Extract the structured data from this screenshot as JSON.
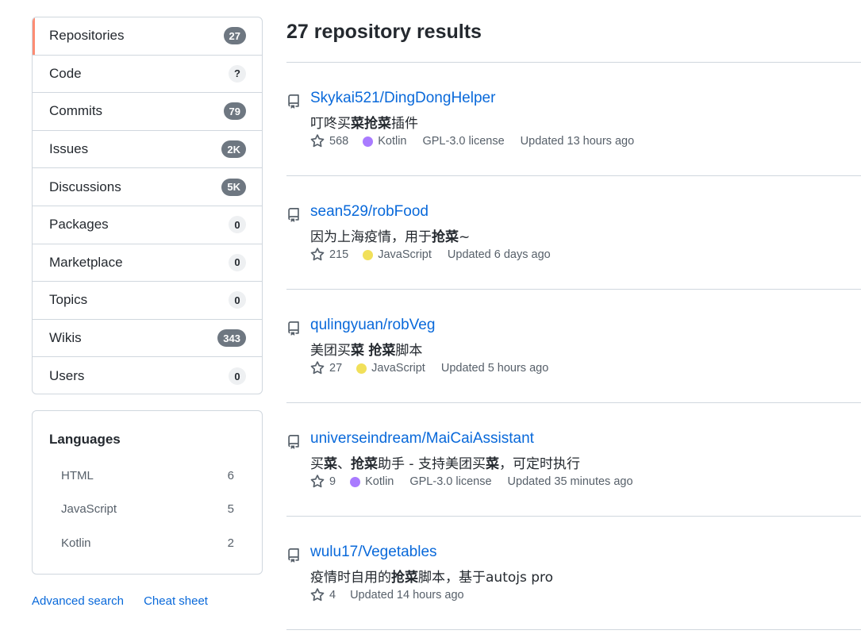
{
  "nav": [
    {
      "label": "Repositories",
      "count": "27",
      "dark": true,
      "selected": true
    },
    {
      "label": "Code",
      "count": "?",
      "dark": false
    },
    {
      "label": "Commits",
      "count": "79",
      "dark": true
    },
    {
      "label": "Issues",
      "count": "2K",
      "dark": true
    },
    {
      "label": "Discussions",
      "count": "5K",
      "dark": true
    },
    {
      "label": "Packages",
      "count": "0",
      "dark": false
    },
    {
      "label": "Marketplace",
      "count": "0",
      "dark": false
    },
    {
      "label": "Topics",
      "count": "0",
      "dark": false
    },
    {
      "label": "Wikis",
      "count": "343",
      "dark": true
    },
    {
      "label": "Users",
      "count": "0",
      "dark": false
    }
  ],
  "languages": {
    "title": "Languages",
    "items": [
      {
        "name": "HTML",
        "count": "6"
      },
      {
        "name": "JavaScript",
        "count": "5"
      },
      {
        "name": "Kotlin",
        "count": "2"
      }
    ]
  },
  "footer": {
    "advanced": "Advanced search",
    "cheat": "Cheat sheet"
  },
  "results_title": "27 repository results",
  "colors": {
    "Kotlin": "#a97bff",
    "JavaScript": "#f1e05a"
  },
  "repos": [
    {
      "name": "Skykai521/DingDongHelper",
      "desc_parts": [
        [
          "叮咚买",
          false
        ],
        [
          "菜抢菜",
          true
        ],
        [
          "插件",
          false
        ]
      ],
      "stars": "568",
      "language": "Kotlin",
      "license": "GPL-3.0 license",
      "updated": "Updated 13 hours ago"
    },
    {
      "name": "sean529/robFood",
      "desc_parts": [
        [
          "因为上海疫情，用于",
          false
        ],
        [
          "抢菜",
          true
        ],
        [
          "~",
          false
        ]
      ],
      "stars": "215",
      "language": "JavaScript",
      "license": "",
      "updated": "Updated 6 days ago"
    },
    {
      "name": "qulingyuan/robVeg",
      "desc_parts": [
        [
          "美团买",
          false
        ],
        [
          "菜",
          true
        ],
        [
          " ",
          false
        ],
        [
          "抢菜",
          true
        ],
        [
          "脚本",
          false
        ]
      ],
      "stars": "27",
      "language": "JavaScript",
      "license": "",
      "updated": "Updated 5 hours ago"
    },
    {
      "name": "universeindream/MaiCaiAssistant",
      "desc_parts": [
        [
          "买",
          false
        ],
        [
          "菜",
          true
        ],
        [
          "、",
          false
        ],
        [
          "抢菜",
          true
        ],
        [
          "助手 - 支持美团买",
          false
        ],
        [
          "菜",
          true
        ],
        [
          "，可定时执行",
          false
        ]
      ],
      "stars": "9",
      "language": "Kotlin",
      "license": "GPL-3.0 license",
      "updated": "Updated 35 minutes ago"
    },
    {
      "name": "wulu17/Vegetables",
      "desc_parts": [
        [
          "疫情时自用的",
          false
        ],
        [
          "抢菜",
          true
        ],
        [
          "脚本，基于autojs pro",
          false
        ]
      ],
      "stars": "4",
      "language": "",
      "license": "",
      "updated": "Updated 14 hours ago"
    }
  ]
}
